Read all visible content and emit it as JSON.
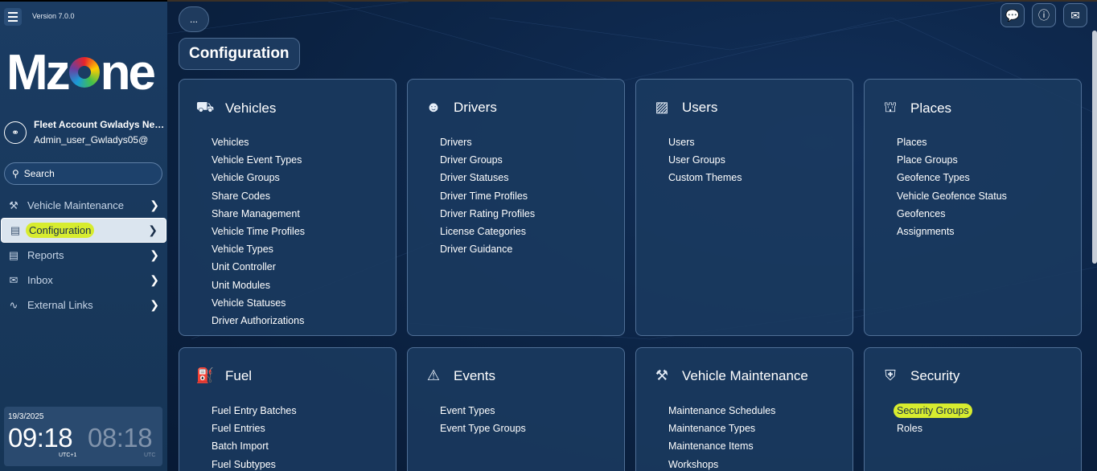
{
  "app": {
    "version": "Version 7.0.0",
    "logo_text": "Mzone"
  },
  "account": {
    "name": "Fleet Account Gwladys New...",
    "user": "Admin_user_Gwladys05@"
  },
  "search": {
    "label": "Search"
  },
  "menu": [
    {
      "label": "Vehicle Maintenance",
      "icon": "wrench-car-icon"
    },
    {
      "label": "Configuration",
      "icon": "monitor-icon",
      "active": true
    },
    {
      "label": "Reports",
      "icon": "report-icon"
    },
    {
      "label": "Inbox",
      "icon": "mail-icon"
    },
    {
      "label": "External Links",
      "icon": "link-icon"
    }
  ],
  "clock": {
    "date": "19/3/2025",
    "local_time": "09:18",
    "local_tz": "UTC+1",
    "utc_time": "08:18",
    "utc_tz": "UTC"
  },
  "header": {
    "ellipsis": "...",
    "page_title": "Configuration"
  },
  "top_buttons": [
    "chat-icon",
    "info-icon",
    "mail-icon"
  ],
  "cards": {
    "vehicles": {
      "title": "Vehicles",
      "icon": "car-icon",
      "items": [
        "Vehicles",
        "Vehicle Event Types",
        "Vehicle Groups",
        "Share Codes",
        "Share Management",
        "Vehicle Time Profiles",
        "Vehicle Types",
        "Unit Controller",
        "Unit Modules",
        "Vehicle Statuses",
        "Driver Authorizations"
      ]
    },
    "drivers": {
      "title": "Drivers",
      "icon": "driver-icon",
      "items": [
        "Drivers",
        "Driver Groups",
        "Driver Statuses",
        "Driver Time Profiles",
        "Driver Rating Profiles",
        "License Categories",
        "Driver Guidance"
      ]
    },
    "users": {
      "title": "Users",
      "icon": "user-card-icon",
      "items": [
        "Users",
        "User Groups",
        "Custom Themes"
      ]
    },
    "places": {
      "title": "Places",
      "icon": "map-icon",
      "items": [
        "Places",
        "Place Groups",
        "Geofence Types",
        "Vehicle Geofence Status",
        "Geofences",
        "Assignments"
      ]
    },
    "fuel": {
      "title": "Fuel",
      "icon": "fuel-pump-icon",
      "items": [
        "Fuel Entry Batches",
        "Fuel Entries",
        "Batch Import",
        "Fuel Subtypes"
      ]
    },
    "events": {
      "title": "Events",
      "icon": "events-icon",
      "items": [
        "Event Types",
        "Event Type Groups"
      ]
    },
    "maintenance": {
      "title": "Vehicle Maintenance",
      "icon": "car-tools-icon",
      "items": [
        "Maintenance Schedules",
        "Maintenance Types",
        "Maintenance Items",
        "Workshops"
      ]
    },
    "security": {
      "title": "Security",
      "icon": "shield-lock-icon",
      "items": [
        "Security Groups",
        "Roles"
      ]
    }
  }
}
